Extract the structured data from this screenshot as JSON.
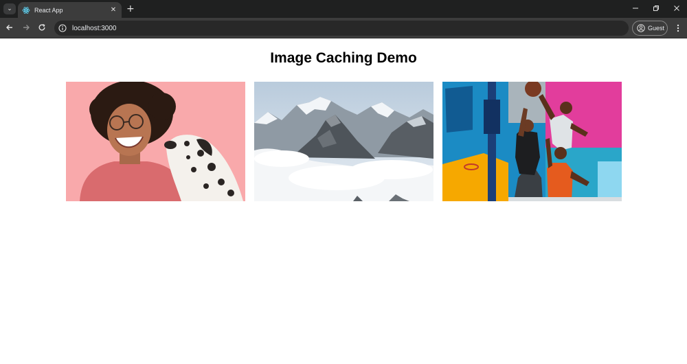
{
  "browser": {
    "tab": {
      "title": "React App"
    },
    "address_bar": {
      "url": "localhost:3000"
    },
    "profile": {
      "label": "Guest"
    }
  },
  "page": {
    "title": "Image Caching Demo"
  },
  "icons": {
    "tab_search": "chevron-down-icon",
    "favicon": "react-logo-icon",
    "tab_close": "close-icon",
    "new_tab": "plus-icon",
    "back": "arrow-left-icon",
    "forward": "arrow-right-icon",
    "reload": "reload-icon",
    "site_info": "info-icon",
    "profile": "person-icon",
    "menu": "kebab-menu-icon",
    "minimize": "minimize-icon",
    "restore": "restore-icon",
    "close_window": "close-icon"
  },
  "colors": {
    "chrome_dark": "#1f2020",
    "toolbar": "#3c3c3c",
    "omnibox": "#282828",
    "page_background": "#ffffff",
    "photo1_background": "#f9a9ab",
    "photo3_blue": "#1b8bc4",
    "photo3_magenta": "#e23d9c"
  }
}
